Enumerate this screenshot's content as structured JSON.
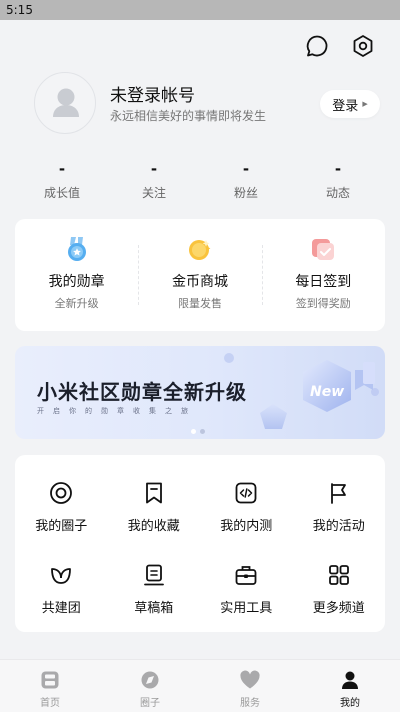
{
  "status": {
    "time": "5:15"
  },
  "header": {
    "icons": [
      "message-icon",
      "settings-icon"
    ]
  },
  "profile": {
    "name": "未登录帐号",
    "tagline": "永远相信美好的事情即将发生",
    "login_label": "登录"
  },
  "stats": [
    {
      "value": "-",
      "label": "成长值"
    },
    {
      "value": "-",
      "label": "关注"
    },
    {
      "value": "-",
      "label": "粉丝"
    },
    {
      "value": "-",
      "label": "动态"
    }
  ],
  "features": [
    {
      "title": "我的勋章",
      "sub": "全新升级",
      "icon": "medal-icon"
    },
    {
      "title": "金币商城",
      "sub": "限量发售",
      "icon": "coin-icon"
    },
    {
      "title": "每日签到",
      "sub": "签到得奖励",
      "icon": "checkin-icon"
    }
  ],
  "banner": {
    "title": "小米社区勋章全新升级",
    "subtitle": "开启你的勋章收集之旅",
    "badge_text": "New",
    "slide_count": 2,
    "active_slide": 1
  },
  "menu": [
    {
      "label": "我的圈子",
      "icon": "circle-target-icon"
    },
    {
      "label": "我的收藏",
      "icon": "bookmark-icon"
    },
    {
      "label": "我的内测",
      "icon": "code-icon"
    },
    {
      "label": "我的活动",
      "icon": "flag-icon"
    },
    {
      "label": "共建团",
      "icon": "leaf-icon"
    },
    {
      "label": "草稿箱",
      "icon": "draft-icon"
    },
    {
      "label": "实用工具",
      "icon": "toolbox-icon"
    },
    {
      "label": "更多频道",
      "icon": "grid-icon"
    }
  ],
  "tabs": [
    {
      "label": "首页",
      "icon": "home-icon",
      "active": false
    },
    {
      "label": "圈子",
      "icon": "circle-icon",
      "active": false
    },
    {
      "label": "服务",
      "icon": "heart-icon",
      "active": false
    },
    {
      "label": "我的",
      "icon": "person-icon",
      "active": true
    }
  ],
  "colors": {
    "accent": "#111111",
    "muted": "#9a9a9a",
    "background": "#f2f3f5"
  }
}
